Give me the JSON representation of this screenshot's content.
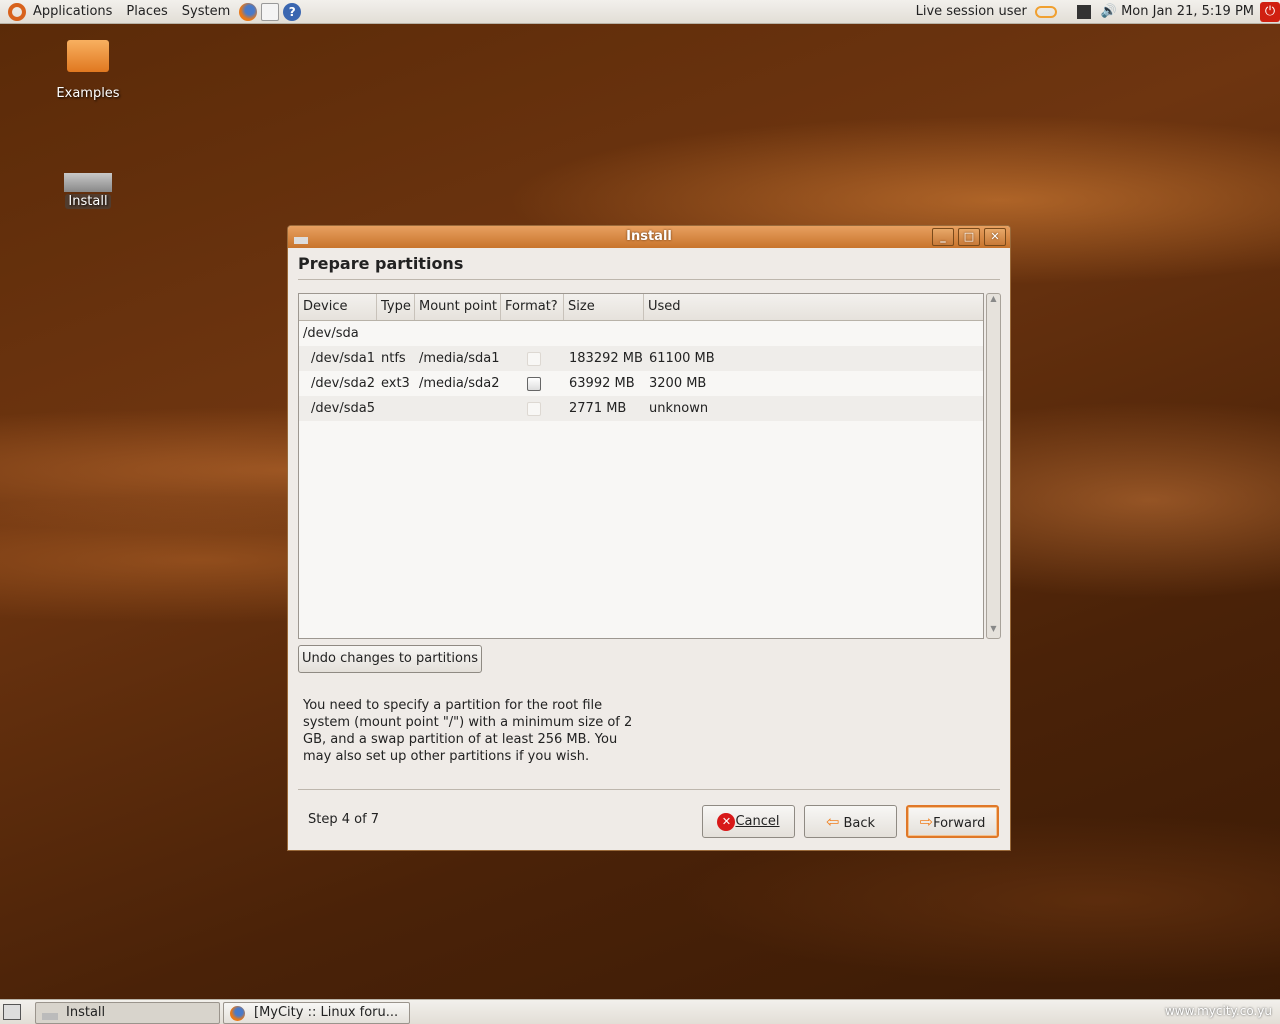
{
  "top_panel": {
    "menus": [
      "Applications",
      "Places",
      "System"
    ],
    "user": "Live session user",
    "clock": "Mon Jan 21,  5:19 PM"
  },
  "desktop": {
    "icons": [
      {
        "label": "Examples"
      },
      {
        "label": "Install"
      }
    ]
  },
  "dialog": {
    "title": "Install",
    "heading": "Prepare partitions",
    "columns": [
      "Device",
      "Type",
      "Mount point",
      "Format?",
      "Size",
      "Used"
    ],
    "disk": "/dev/sda",
    "rows": [
      {
        "device": "/dev/sda1",
        "type": "ntfs",
        "mount": "/media/sda1",
        "format": false,
        "size": "183292 MB",
        "used": "61100 MB"
      },
      {
        "device": "/dev/sda2",
        "type": "ext3",
        "mount": "/media/sda2",
        "format": false,
        "size": "63992 MB",
        "used": "3200 MB"
      },
      {
        "device": "/dev/sda5",
        "type": "",
        "mount": "",
        "format": false,
        "size": "2771 MB",
        "used": "unknown"
      }
    ],
    "undo_label": "Undo changes to partitions",
    "description": "You need to specify a partition for the root file system (mount point \"/\") with a minimum size of 2 GB, and a swap partition of at least 256 MB. You may also set up other partitions if you wish.",
    "step": "Step 4 of 7",
    "cancel": "Cancel",
    "back": "Back",
    "forward": "Forward"
  },
  "taskbar": {
    "items": [
      "Install",
      "[MyCity :: Linux foru..."
    ],
    "watermark": "www.mycity.co.yu"
  }
}
